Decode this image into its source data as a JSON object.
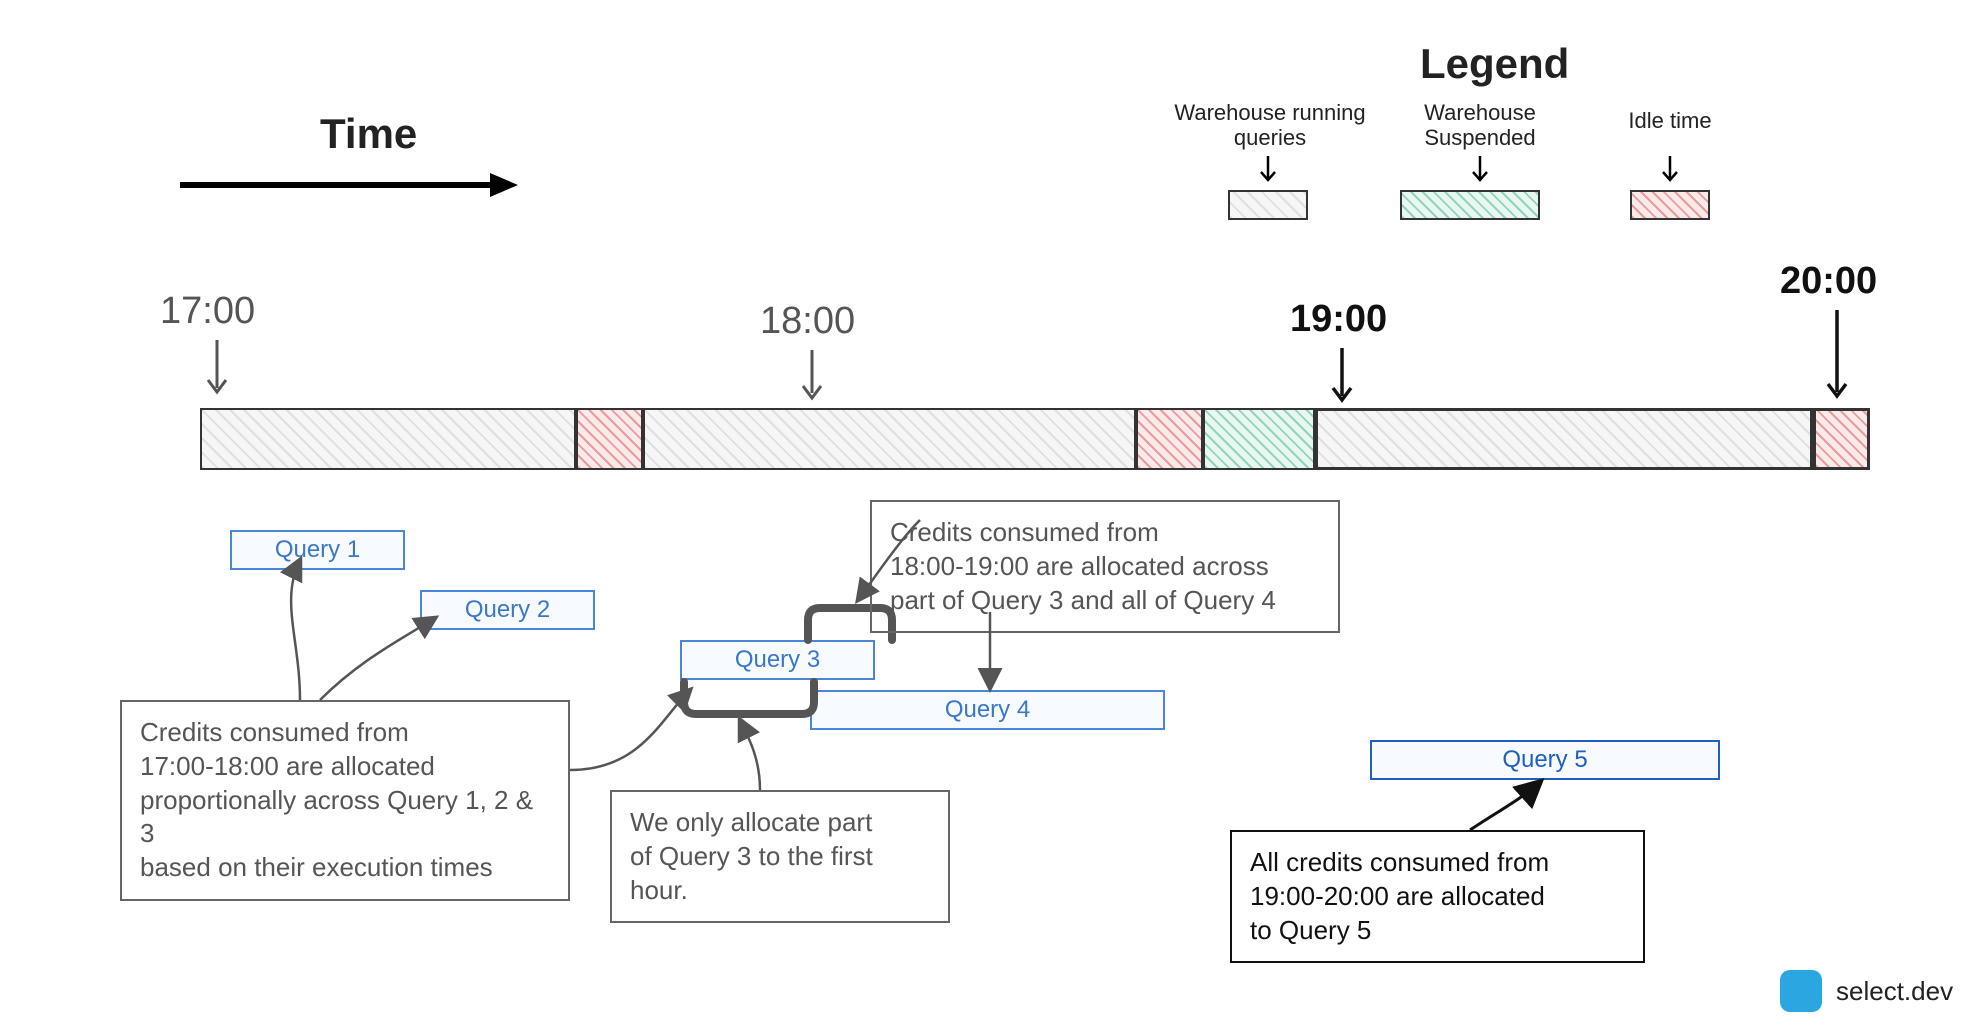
{
  "header": {
    "time_label": "Time",
    "legend_title": "Legend"
  },
  "legend": [
    {
      "name": "running",
      "label": "Warehouse running\nqueries"
    },
    {
      "name": "suspended",
      "label": "Warehouse\nSuspended"
    },
    {
      "name": "idle",
      "label": "Idle time"
    }
  ],
  "ticks": [
    {
      "label": "17:00",
      "emph": false
    },
    {
      "label": "18:00",
      "emph": false
    },
    {
      "label": "19:00",
      "emph": true
    },
    {
      "label": "20:00",
      "emph": true
    }
  ],
  "timeline_segments": [
    {
      "state": "running",
      "from_pct": 0.0,
      "to_pct": 22.5
    },
    {
      "state": "idle",
      "from_pct": 22.5,
      "to_pct": 26.5
    },
    {
      "state": "running",
      "from_pct": 26.5,
      "to_pct": 56.0
    },
    {
      "state": "idle",
      "from_pct": 56.0,
      "to_pct": 60.0
    },
    {
      "state": "suspended",
      "from_pct": 60.0,
      "to_pct": 66.7
    },
    {
      "state": "running",
      "from_pct": 66.7,
      "to_pct": 96.5
    },
    {
      "state": "idle",
      "from_pct": 96.5,
      "to_pct": 100.0
    }
  ],
  "queries": [
    {
      "id": "q1",
      "label": "Query 1"
    },
    {
      "id": "q2",
      "label": "Query 2"
    },
    {
      "id": "q3",
      "label": "Query 3"
    },
    {
      "id": "q4",
      "label": "Query 4"
    },
    {
      "id": "q5",
      "label": "Query 5"
    }
  ],
  "notes": {
    "n1": "Credits consumed from\n17:00-18:00 are allocated\nproportionally across Query 1, 2 & 3\nbased on their execution times",
    "n2": "We only allocate part\nof Query 3 to the first\nhour.",
    "n3": "Credits consumed from\n18:00-19:00 are allocated across\npart of Query 3 and all of Query 4",
    "n4": "All credits consumed from\n19:00-20:00 are allocated\nto Query 5"
  },
  "footer": {
    "brand": "select.dev"
  }
}
